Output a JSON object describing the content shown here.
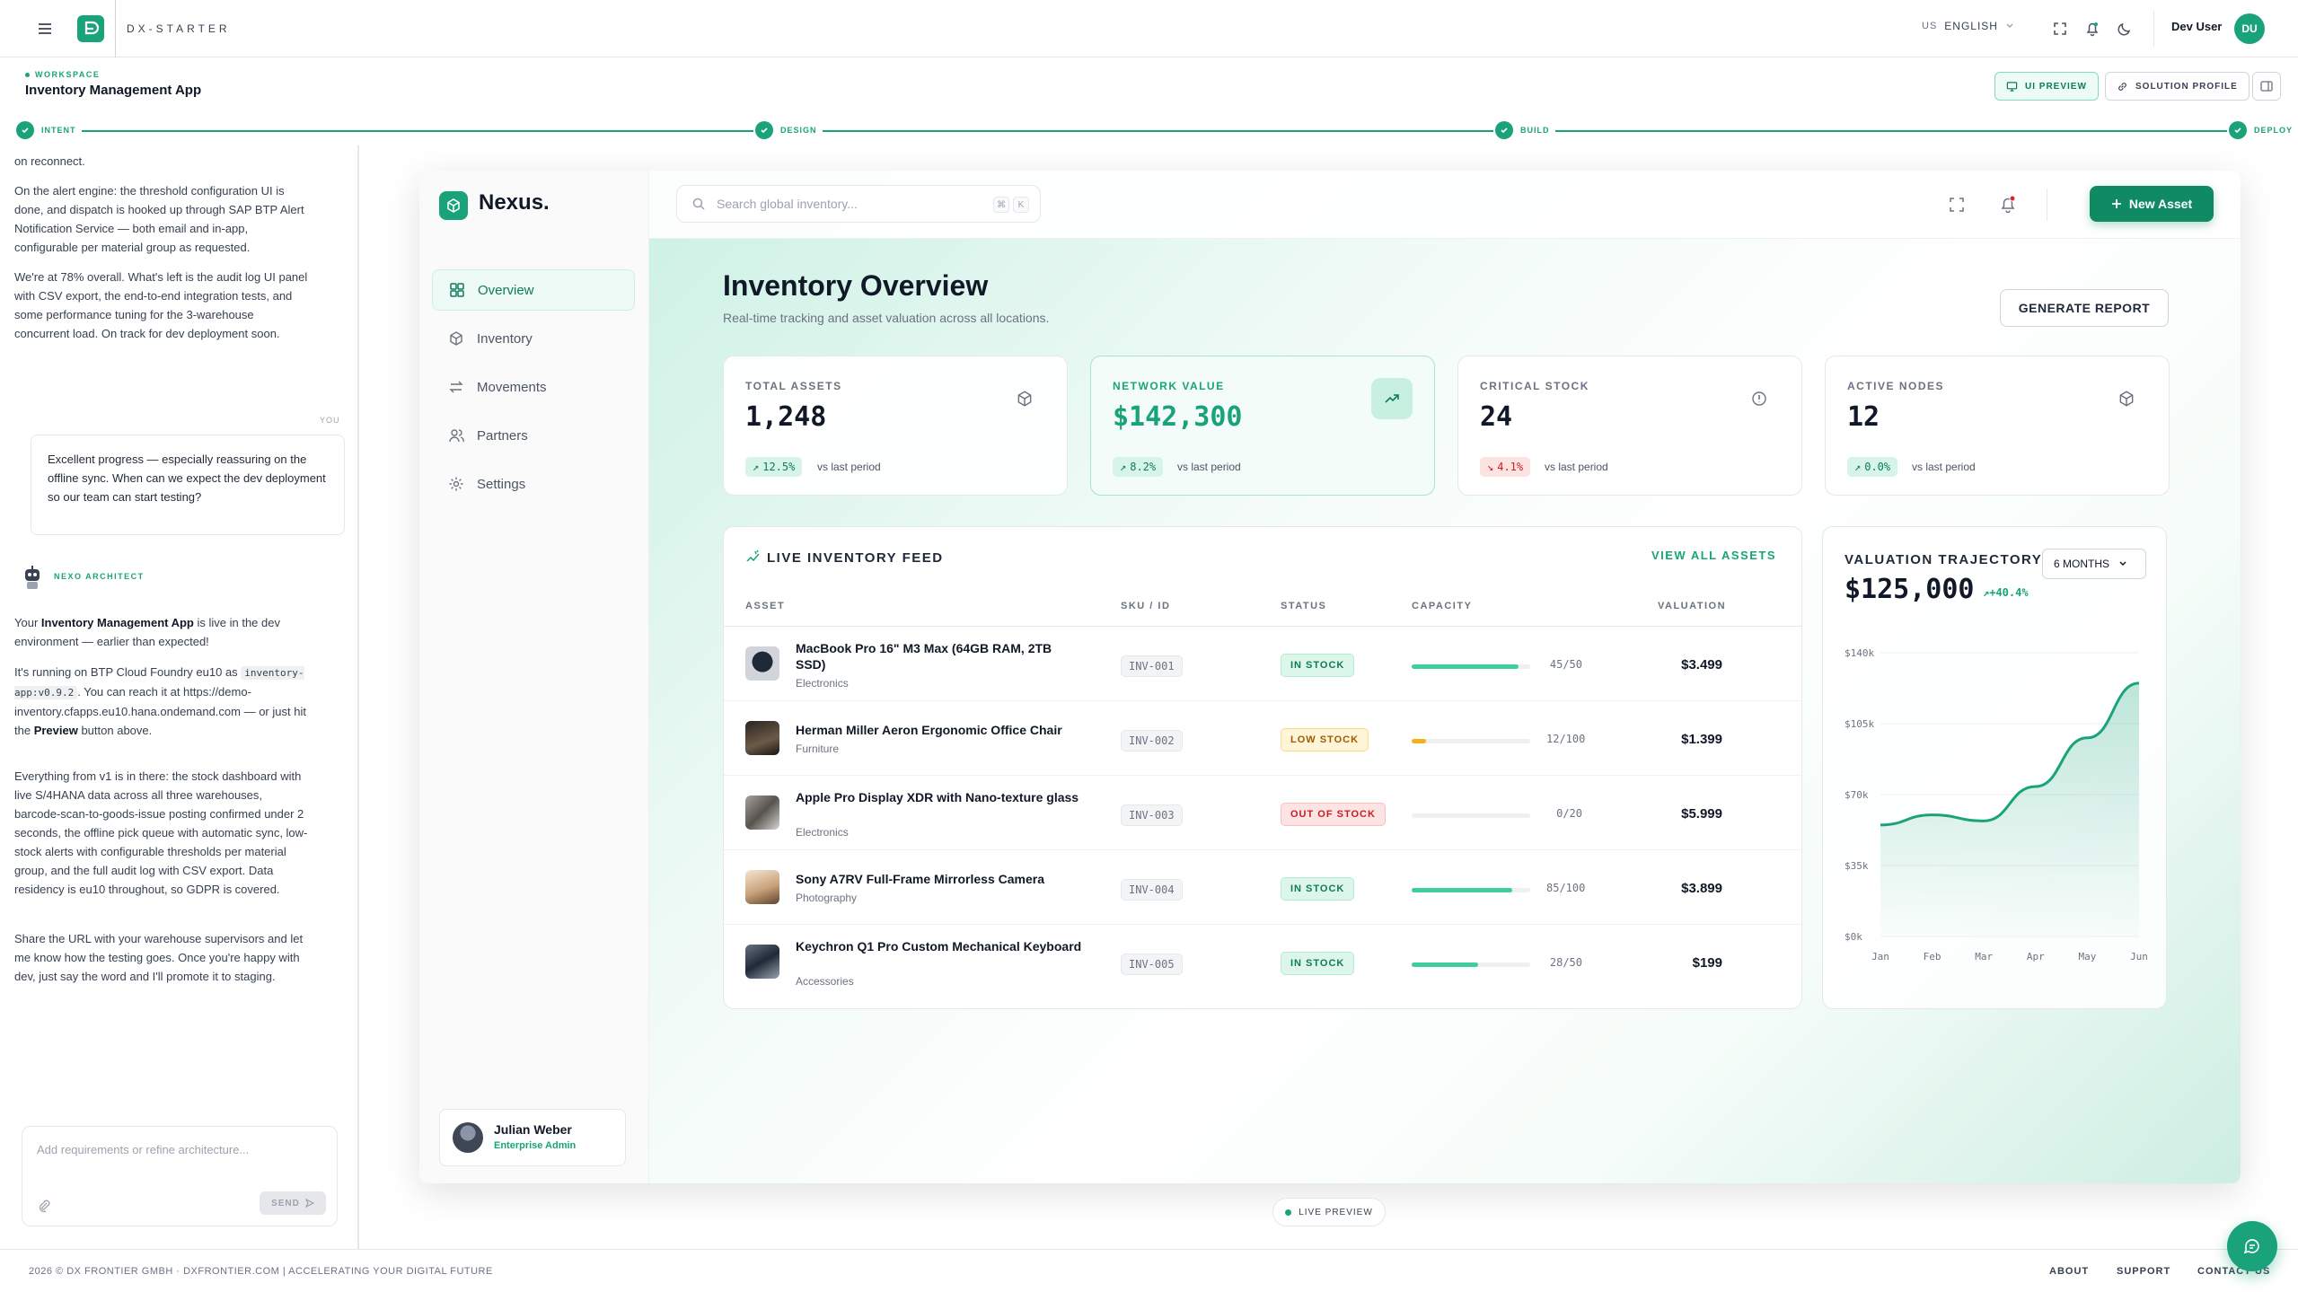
{
  "topbar": {
    "brand": "DX-STARTER",
    "lang_code": "US",
    "lang": "ENGLISH",
    "user": "Dev User",
    "user_initials": "DU"
  },
  "workspace": {
    "label": "WORKSPACE",
    "title": "Inventory Management App",
    "btn_preview": "UI PREVIEW",
    "btn_profile": "SOLUTION PROFILE"
  },
  "stepper": {
    "s1": "INTENT",
    "s2": "DESIGN",
    "s3": "BUILD",
    "s4": "DEPLOY"
  },
  "chat": {
    "m1": "on reconnect.",
    "m2": "On the alert engine: the threshold configuration UI is done, and dispatch is hooked up through SAP BTP Alert Notification Service — both email and in-app, configurable per material group as requested.",
    "m3": "We're at 78% overall. What's left is the audit log UI panel with CSV export, the end-to-end integration tests, and some performance tuning for the 3-warehouse concurrent load. On track for dev deployment soon.",
    "you": "YOU",
    "user_msg": "Excellent progress — especially reassuring on the offline sync. When can we expect the dev deployment so our team can start testing?",
    "arch": "NEXO ARCHITECT",
    "r1a": "Your ",
    "r1b": "Inventory Management App",
    "r1c": " is live in the dev environment — earlier than expected!",
    "r2a": "It's running on BTP Cloud Foundry eu10 as ",
    "r2code": "inventory-app:v0.9.2",
    "r2b": ". You can reach it at https://demo-inventory.cfapps.eu10.hana.ondemand.com — or just hit the ",
    "r2c": "Preview",
    "r2d": " button above.",
    "r3": "Everything from v1 is in there: the stock dashboard with live S/4HANA data across all three warehouses, barcode-scan-to-goods-issue posting confirmed under 2 seconds, the offline pick queue with automatic sync, low-stock alerts with configurable thresholds per material group, and the full audit log with CSV export. Data residency is eu10 throughout, so GDPR is covered.",
    "r4": "Share the URL with your warehouse supervisors and let me know how the testing goes. Once you're happy with dev, just say the word and I'll promote it to staging.",
    "placeholder": "Add requirements or refine architecture...",
    "send": "SEND"
  },
  "app": {
    "brand": "Nexus.",
    "nav": [
      "Overview",
      "Inventory",
      "Movements",
      "Partners",
      "Settings"
    ],
    "profile_name": "Julian Weber",
    "profile_role": "Enterprise Admin",
    "search_placeholder": "Search global inventory...",
    "kbd1": "⌘",
    "kbd2": "K",
    "new_asset": "New Asset",
    "title": "Inventory Overview",
    "subtitle": "Real-time tracking and asset valuation across all locations.",
    "generate": "GENERATE REPORT",
    "kpis": [
      {
        "label": "TOTAL ASSETS",
        "value": "1,248",
        "delta": "12.5%",
        "vs": "vs last period"
      },
      {
        "label": "NETWORK VALUE",
        "value": "$142,300",
        "delta": "8.2%",
        "vs": "vs last period"
      },
      {
        "label": "CRITICAL STOCK",
        "value": "24",
        "delta": "4.1%",
        "vs": "vs last period"
      },
      {
        "label": "ACTIVE NODES",
        "value": "12",
        "delta": "0.0%",
        "vs": "vs last period"
      }
    ],
    "feed": {
      "title": "LIVE INVENTORY FEED",
      "view_all": "VIEW ALL ASSETS",
      "headers": [
        "ASSET",
        "SKU / ID",
        "STATUS",
        "CAPACITY",
        "VALUATION"
      ],
      "rows": [
        {
          "name": "MacBook Pro 16\" M3 Max (64GB RAM, 2TB SSD)",
          "cat": "Electronics",
          "sku": "INV-001",
          "status": "IN STOCK",
          "cap": "45/50",
          "fill": 0.9,
          "val": "$3.499"
        },
        {
          "name": "Herman Miller Aeron Ergonomic Office Chair",
          "cat": "Furniture",
          "sku": "INV-002",
          "status": "LOW STOCK",
          "cap": "12/100",
          "fill": 0.12,
          "val": "$1.399"
        },
        {
          "name": "Apple Pro Display XDR with Nano-texture glass",
          "cat": "Electronics",
          "sku": "INV-003",
          "status": "OUT OF STOCK",
          "cap": "0/20",
          "fill": 0,
          "val": "$5.999"
        },
        {
          "name": "Sony A7RV Full-Frame Mirrorless Camera",
          "cat": "Photography",
          "sku": "INV-004",
          "status": "IN STOCK",
          "cap": "85/100",
          "fill": 0.85,
          "val": "$3.899"
        },
        {
          "name": "Keychron Q1 Pro Custom Mechanical Keyboard",
          "cat": "Accessories",
          "sku": "INV-005",
          "status": "IN STOCK",
          "cap": "28/50",
          "fill": 0.56,
          "val": "$199"
        }
      ]
    },
    "valuation": {
      "title": "VALUATION TRAJECTORY",
      "value": "$125,000",
      "growth": "+40.4%",
      "range": "6 MONTHS"
    }
  },
  "chart_data": {
    "type": "area",
    "title": "VALUATION TRAJECTORY",
    "categories": [
      "Jan",
      "Feb",
      "Mar",
      "Apr",
      "May",
      "Jun"
    ],
    "values": [
      55000,
      60000,
      57000,
      74000,
      98000,
      125000
    ],
    "yticks": [
      "$0k",
      "$35k",
      "$70k",
      "$105k",
      "$140k"
    ],
    "ylim": [
      0,
      140000
    ]
  },
  "live_preview": "LIVE PREVIEW",
  "footer": {
    "left": "2026 © DX FRONTIER GMBH · DXFRONTIER.COM | ACCELERATING YOUR DIGITAL FUTURE",
    "about": "ABOUT",
    "support": "SUPPORT",
    "contact": "CONTACT US"
  },
  "colors": {
    "accent": "#1aa37a",
    "danger": "#c81e1e",
    "warn": "#f2b01e"
  }
}
